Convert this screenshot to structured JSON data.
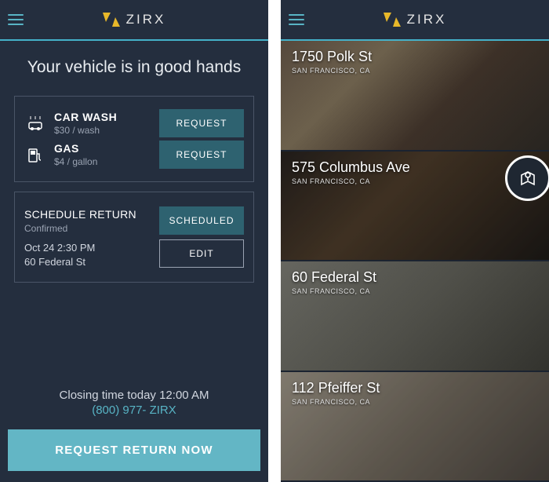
{
  "brand": "ZIRX",
  "left": {
    "headline": "Your vehicle is in good hands",
    "services": [
      {
        "icon": "car-wash",
        "title": "CAR WASH",
        "sub": "$30 / wash",
        "action": "REQUEST"
      },
      {
        "icon": "gas-pump",
        "title": "GAS",
        "sub": "$4 / gallon",
        "action": "REQUEST"
      }
    ],
    "schedule": {
      "title": "SCHEDULE RETURN",
      "status_sub": "Confirmed",
      "badge": "SCHEDULED",
      "datetime": "Oct 24  2:30 PM",
      "address": "60 Federal St",
      "edit": "EDIT"
    },
    "closing": "Closing time today 12:00 AM",
    "phone": "(800) 977- ZIRX",
    "cta": "REQUEST RETURN NOW"
  },
  "right": {
    "locations": [
      {
        "addr": "1750 Polk St",
        "city": "SAN FRANCISCO, CA"
      },
      {
        "addr": "575 Columbus Ave",
        "city": "SAN FRANCISCO, CA"
      },
      {
        "addr": "60 Federal St",
        "city": "SAN FRANCISCO, CA"
      },
      {
        "addr": "112 Pfeiffer St",
        "city": "SAN FRANCISCO, CA"
      }
    ]
  }
}
